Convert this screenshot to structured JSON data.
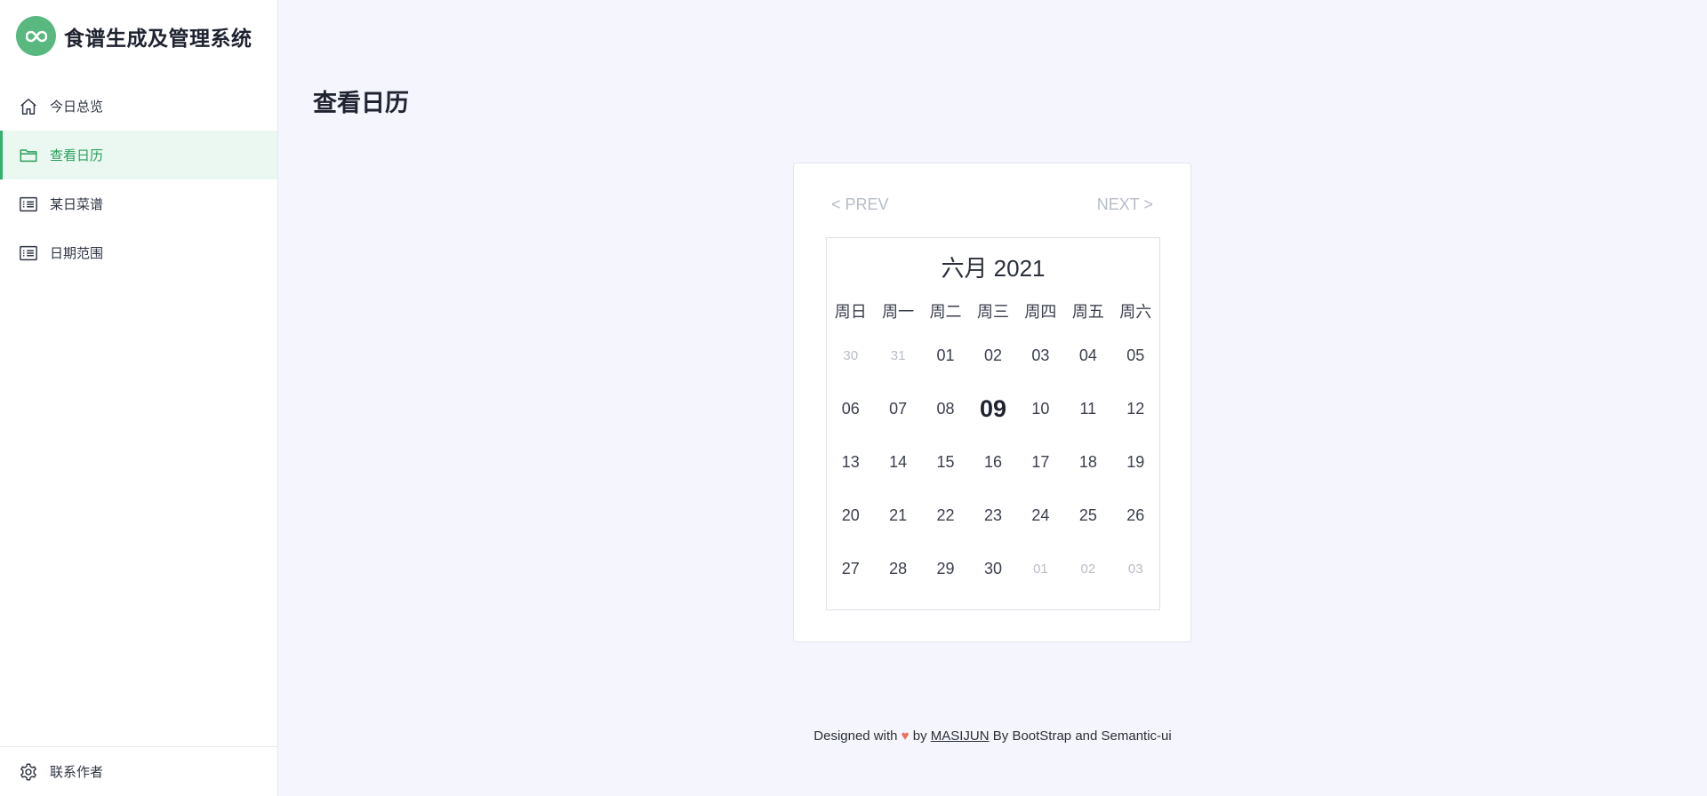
{
  "app": {
    "title": "食谱生成及管理系统",
    "logo_icon": "infinity-icon",
    "brand_color": "#58b87f"
  },
  "sidebar": {
    "items": [
      {
        "label": "今日总览",
        "icon": "home-icon",
        "active": false
      },
      {
        "label": "查看日历",
        "icon": "folder-icon",
        "active": true
      },
      {
        "label": "某日菜谱",
        "icon": "list-icon",
        "active": false
      },
      {
        "label": "日期范围",
        "icon": "list-icon",
        "active": false
      }
    ],
    "footer_item": {
      "label": "联系作者",
      "icon": "gear-icon"
    }
  },
  "page": {
    "title": "查看日历"
  },
  "calendar": {
    "prev_label": "< PREV",
    "next_label": "NEXT >",
    "month_label": "六月 2021",
    "weekdays": [
      "周日",
      "周一",
      "周二",
      "周三",
      "周四",
      "周五",
      "周六"
    ],
    "weeks": [
      [
        {
          "d": "30",
          "muted": true
        },
        {
          "d": "31",
          "muted": true
        },
        {
          "d": "01"
        },
        {
          "d": "02"
        },
        {
          "d": "03"
        },
        {
          "d": "04"
        },
        {
          "d": "05"
        }
      ],
      [
        {
          "d": "06"
        },
        {
          "d": "07"
        },
        {
          "d": "08"
        },
        {
          "d": "09",
          "today": true
        },
        {
          "d": "10"
        },
        {
          "d": "11"
        },
        {
          "d": "12"
        }
      ],
      [
        {
          "d": "13"
        },
        {
          "d": "14"
        },
        {
          "d": "15"
        },
        {
          "d": "16"
        },
        {
          "d": "17"
        },
        {
          "d": "18"
        },
        {
          "d": "19"
        }
      ],
      [
        {
          "d": "20"
        },
        {
          "d": "21"
        },
        {
          "d": "22"
        },
        {
          "d": "23"
        },
        {
          "d": "24"
        },
        {
          "d": "25"
        },
        {
          "d": "26"
        }
      ],
      [
        {
          "d": "27"
        },
        {
          "d": "28"
        },
        {
          "d": "29"
        },
        {
          "d": "30"
        },
        {
          "d": "01",
          "muted": true
        },
        {
          "d": "02",
          "muted": true
        },
        {
          "d": "03",
          "muted": true
        }
      ]
    ]
  },
  "footer": {
    "prefix": "Designed with",
    "by": "by",
    "author": "MASIJUN",
    "suffix": "By BootStrap and Semantic-ui"
  },
  "colors": {
    "accent": "#33b06b",
    "active_bg": "#eaf8f1",
    "heart": "#e8715a",
    "page_bg": "#f5f6fd"
  }
}
